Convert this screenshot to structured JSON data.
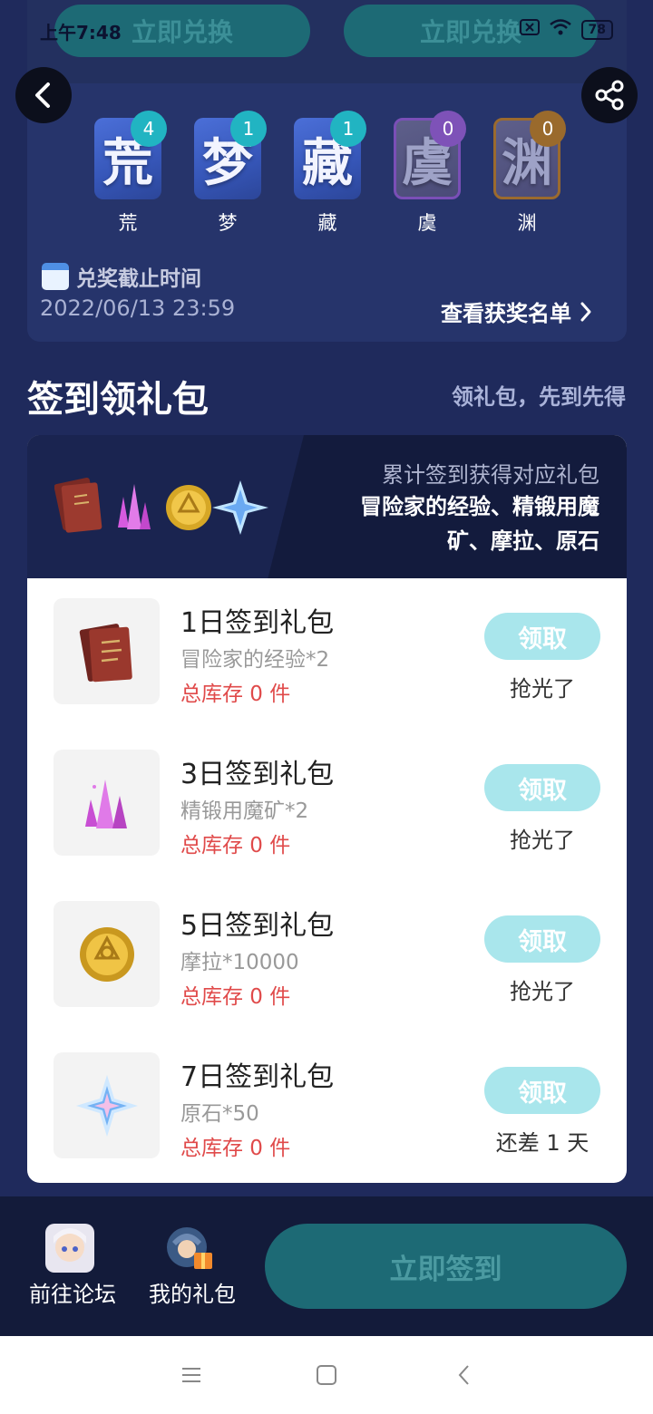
{
  "status_bar": {
    "time": "上午7:48",
    "battery": "78"
  },
  "top": {
    "redeem_left": "立即兑换",
    "redeem_right": "立即兑换",
    "characters": [
      {
        "glyph": "荒",
        "label": "荒",
        "count": "4"
      },
      {
        "glyph": "梦",
        "label": "梦",
        "count": "1"
      },
      {
        "glyph": "藏",
        "label": "藏",
        "count": "1"
      },
      {
        "glyph": "虞",
        "label": "虞",
        "count": "0"
      },
      {
        "glyph": "渊",
        "label": "渊",
        "count": "0"
      }
    ],
    "deadline_title": "兑奖截止时间",
    "deadline_value": "2022/06/13 23:59",
    "winners_link": "查看获奖名单"
  },
  "signin": {
    "title": "签到领礼包",
    "subtitle": "领礼包，先到先得",
    "header_sub": "累计签到获得对应礼包",
    "header_desc": "冒险家的经验、精锻用魔矿、摩拉、原石",
    "claim_label": "领取",
    "gifts": [
      {
        "name": "1日签到礼包",
        "item": "冒险家的经验*2",
        "stock": "总库存 0 件",
        "status": "抢光了",
        "icon": "adventurer-book"
      },
      {
        "name": "3日签到礼包",
        "item": "精锻用魔矿*2",
        "stock": "总库存 0 件",
        "status": "抢光了",
        "icon": "mystic-ore"
      },
      {
        "name": "5日签到礼包",
        "item": "摩拉*10000",
        "stock": "总库存 0 件",
        "status": "抢光了",
        "icon": "mora-coin"
      },
      {
        "name": "7日签到礼包",
        "item": "原石*50",
        "stock": "总库存 0 件",
        "status": "还差 1 天",
        "icon": "primogem"
      }
    ]
  },
  "bottom": {
    "forum_label": "前往论坛",
    "mygift_label": "我的礼包",
    "signin_button": "立即签到"
  },
  "colors": {
    "background": "#1f2a5c",
    "accent_teal": "#21b4c2",
    "disabled_button": "#1d6a75",
    "claim_button": "#a9e6ec",
    "stock_red": "#e04a4a"
  }
}
